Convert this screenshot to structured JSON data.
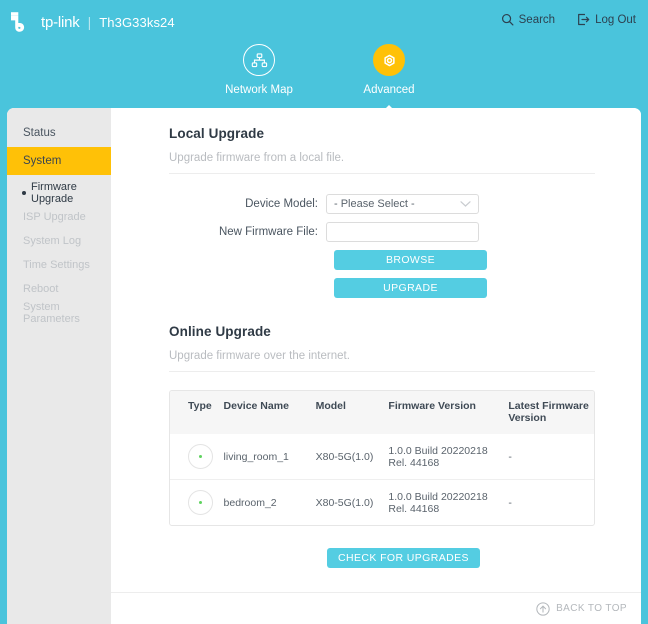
{
  "header": {
    "brand_name": "tp-link",
    "separator": "|",
    "device_name": "Th3G33ks24",
    "search_label": "Search",
    "logout_label": "Log Out",
    "background_color": "#4ac4dc"
  },
  "nav": {
    "tabs": [
      {
        "label": "Network Map",
        "icon": "network-map-icon",
        "active": false
      },
      {
        "label": "Advanced",
        "icon": "gear-icon",
        "active": true
      }
    ],
    "active_color": "#ffc107"
  },
  "sidebar": {
    "items": [
      {
        "label": "Status",
        "type": "group",
        "state": "normal"
      },
      {
        "label": "System",
        "type": "group",
        "state": "highlight"
      },
      {
        "label": "Firmware Upgrade",
        "type": "sub",
        "state": "active"
      },
      {
        "label": "ISP Upgrade",
        "type": "sub",
        "state": "normal"
      },
      {
        "label": "System Log",
        "type": "sub",
        "state": "normal"
      },
      {
        "label": "Time Settings",
        "type": "sub",
        "state": "normal"
      },
      {
        "label": "Reboot",
        "type": "sub",
        "state": "normal"
      },
      {
        "label": "System Parameters",
        "type": "sub",
        "state": "normal"
      }
    ],
    "highlight_color": "#ffc107",
    "background_color": "#e9e9e9"
  },
  "local_upgrade": {
    "title": "Local Upgrade",
    "description": "Upgrade firmware from a local file.",
    "device_model_label": "Device Model:",
    "device_model_value": "- Please Select -",
    "firmware_file_label": "New Firmware File:",
    "firmware_file_value": "",
    "firmware_file_placeholder": "",
    "browse_label": "BROWSE",
    "upgrade_label": "UPGRADE",
    "button_color": "#54cde2"
  },
  "online_upgrade": {
    "title": "Online Upgrade",
    "description": "Upgrade firmware over the internet.",
    "check_label": "CHECK FOR UPGRADES",
    "columns": [
      "Type",
      "Device Name",
      "Model",
      "Firmware Version",
      "Latest Firmware Version"
    ],
    "rows": [
      {
        "type_icon": "device-status-icon",
        "status_color": "#5fd35f",
        "device_name": "living_room_1",
        "model": "X80-5G(1.0)",
        "firmware_version": "1.0.0 Build 20220218 Rel. 44168",
        "latest_firmware_version": "-"
      },
      {
        "type_icon": "device-status-icon",
        "status_color": "#5fd35f",
        "device_name": "bedroom_2",
        "model": "X80-5G(1.0)",
        "firmware_version": "1.0.0 Build 20220218 Rel. 44168",
        "latest_firmware_version": "-"
      }
    ]
  },
  "footer": {
    "back_to_top_label": "BACK TO TOP"
  }
}
